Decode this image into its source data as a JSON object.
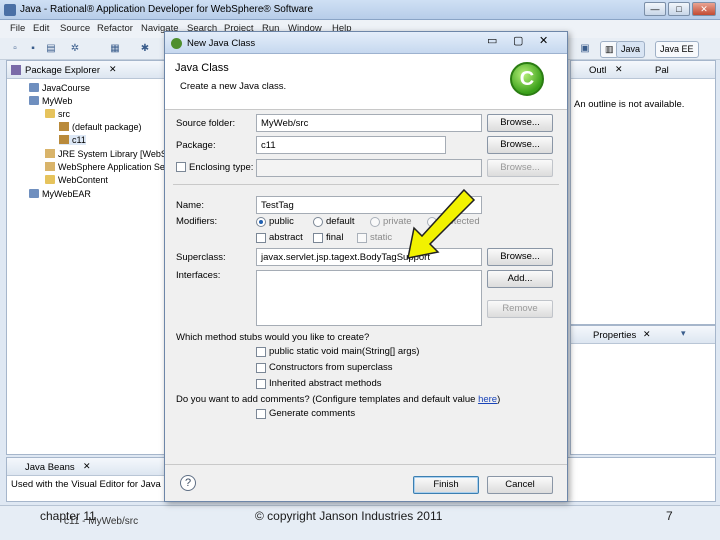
{
  "window": {
    "title": "Java - Rational® Application Developer for WebSphere® Software",
    "controls": [
      "—",
      "□",
      "✕"
    ]
  },
  "menu": [
    "File",
    "Edit",
    "Source",
    "Refactor",
    "Navigate",
    "Search",
    "Project",
    "Run",
    "Window",
    "Help"
  ],
  "perspectives": {
    "java": "Java",
    "javaee": "Java EE"
  },
  "package_explorer": {
    "tab": "Package Explorer",
    "items": [
      "JavaCourse",
      "MyWeb",
      "src",
      "(default package)",
      "c11",
      "JRE System Library [WebSp",
      "WebSphere Application Se",
      "WebContent",
      "MyWebEAR"
    ]
  },
  "outline": {
    "tab": "Outl",
    "tab2": "Pal",
    "message": "An outline is not available."
  },
  "properties": {
    "tab": "Properties"
  },
  "java_beans": {
    "tab": "Java Beans",
    "text": "Used with the Visual Editor for Java"
  },
  "status": {
    "path": "c11 - MyWeb/src"
  },
  "dialog": {
    "title": "New Java Class",
    "heading": "Java Class",
    "subheading": "Create a new Java class.",
    "source_folder_label": "Source folder:",
    "source_folder_value": "MyWeb/src",
    "package_label": "Package:",
    "package_value": "c11",
    "enclosing_label": "Enclosing type:",
    "name_label": "Name:",
    "name_value": "TestTag",
    "modifiers_label": "Modifiers:",
    "mod_public": "public",
    "mod_default": "default",
    "mod_private": "private",
    "mod_protected": "protected",
    "mod_abstract": "abstract",
    "mod_final": "final",
    "mod_static": "static",
    "superclass_label": "Superclass:",
    "superclass_value": "javax.servlet.jsp.tagext.BodyTagSupport",
    "interfaces_label": "Interfaces:",
    "browse": "Browse...",
    "add": "Add...",
    "remove": "Remove",
    "stubs_label": "Which method stubs would you like to create?",
    "stub_main": "public static void main(String[] args)",
    "stub_ctor": "Constructors from superclass",
    "stub_abstract": "Inherited abstract methods",
    "comments_label": "Do you want to add comments? (Configure templates and default value ",
    "comments_link": "here",
    "comments_end": ")",
    "gen_comments": "Generate comments",
    "finish": "Finish",
    "cancel": "Cancel"
  },
  "slide_footer": {
    "left": "chapter 11",
    "center": "© copyright Janson Industries 2011",
    "right": "7"
  },
  "accent": "#1f5fb0",
  "arrow_color": "#f2f200"
}
